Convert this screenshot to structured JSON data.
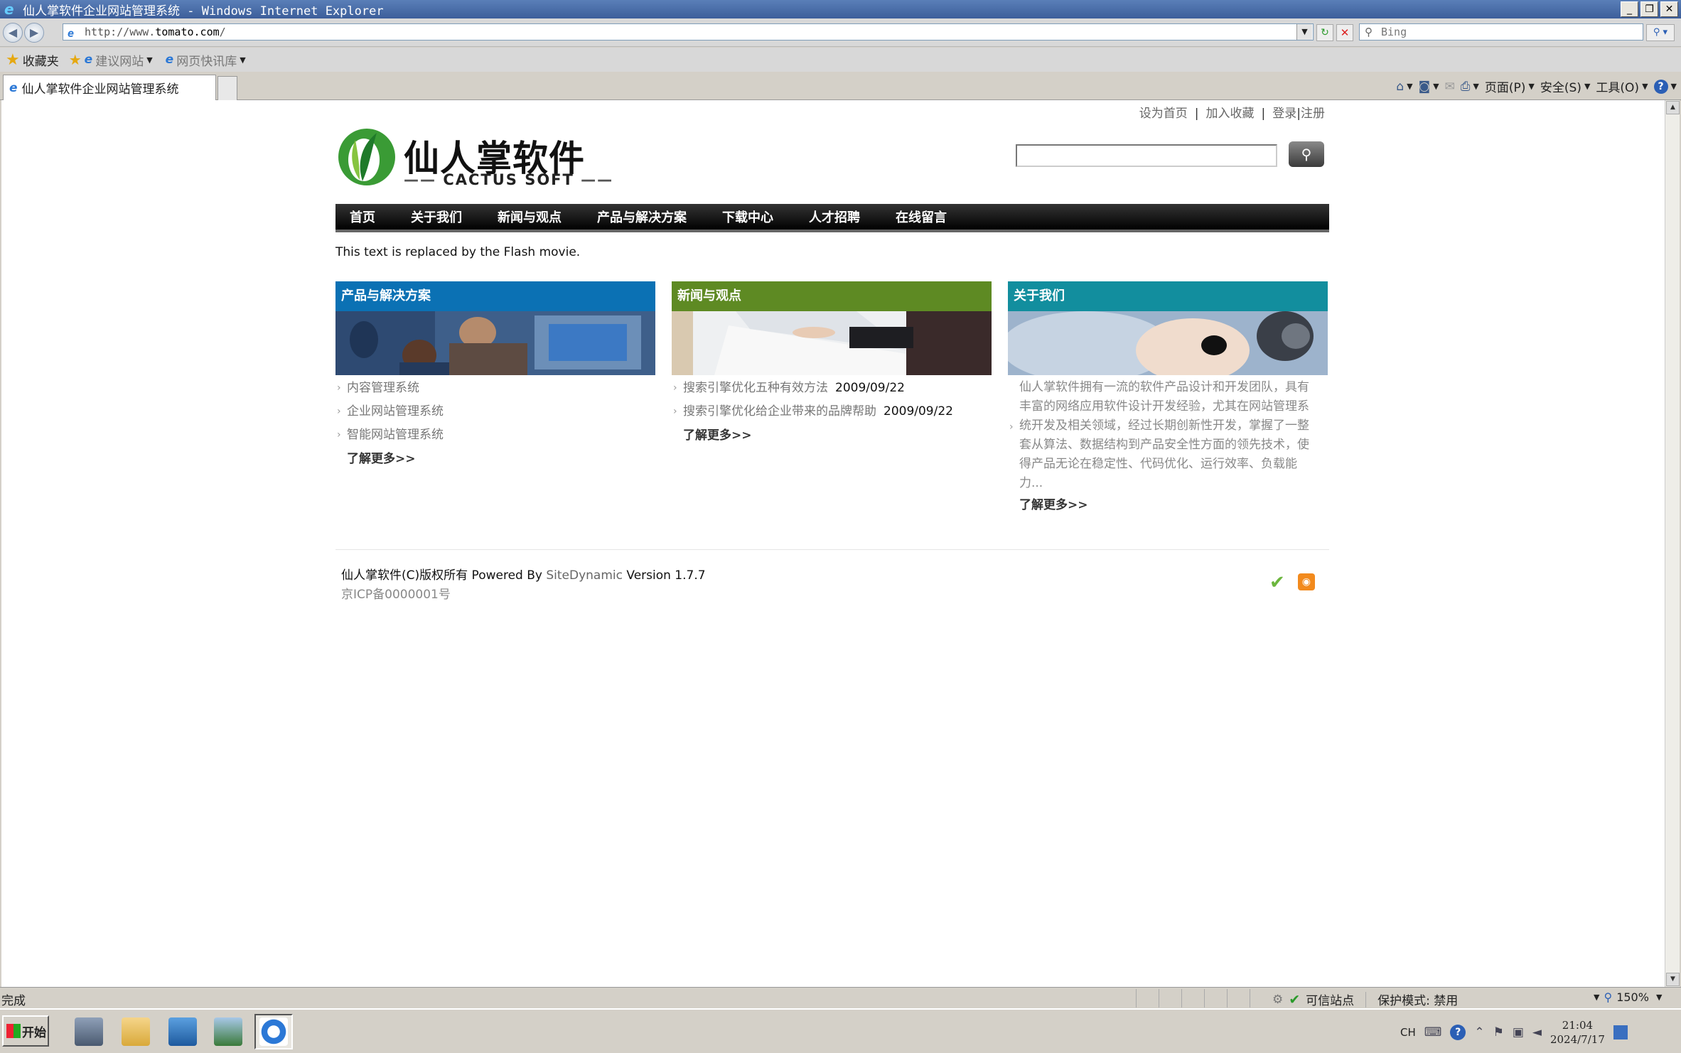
{
  "window": {
    "title": "仙人掌软件企业网站管理系统 - Windows Internet Explorer",
    "controls": [
      "_",
      "❐",
      "✕"
    ]
  },
  "addressbar": {
    "url_prefix": "http://www.",
    "url_host": "tomato.com",
    "url_suffix": "/",
    "search_placeholder": "Bing"
  },
  "favorites": {
    "label": "收藏夹",
    "items": [
      "建议网站",
      "网页快讯库"
    ]
  },
  "tab": {
    "label": "仙人掌软件企业网站管理系统"
  },
  "commandbar": {
    "page": "页面(P)",
    "safety": "安全(S)",
    "tools": "工具(O)"
  },
  "site": {
    "toplinks": {
      "homepage": "设为首页",
      "bookmark": "加入收藏",
      "login": "登录",
      "register": "注册"
    },
    "logo": {
      "cn": "仙人掌软件",
      "en": "CACTUS SOFT"
    },
    "nav": [
      "首页",
      "关于我们",
      "新闻与观点",
      "产品与解决方案",
      "下载中心",
      "人才招聘",
      "在线留言"
    ],
    "flash_text": "This text is replaced by the Flash movie.",
    "columns": {
      "products": {
        "title": "产品与解决方案",
        "items": [
          "内容管理系统",
          "企业网站管理系统",
          "智能网站管理系统"
        ],
        "more": "了解更多>>"
      },
      "news": {
        "title": "新闻与观点",
        "items": [
          {
            "text": "搜索引擎优化五种有效方法",
            "date": "2009/09/22"
          },
          {
            "text": "搜索引擎优化给企业带来的品牌帮助",
            "date": "2009/09/22"
          }
        ],
        "more": "了解更多>>"
      },
      "about": {
        "title": "关于我们",
        "text": "仙人掌软件拥有一流的软件产品设计和开发团队，具有丰富的网络应用软件设计开发经验，尤其在网站管理系统开发及相关领域，经过长期创新性开发，掌握了一整套从算法、数据结构到产品安全性方面的领先技术，使得产品无论在稳定性、代码优化、运行效率、负载能力...",
        "more": "了解更多>>"
      }
    },
    "footer": {
      "copyright": "仙人掌软件(C)版权所有",
      "powered_by": "Powered By",
      "product": "SiteDynamic",
      "version": "Version 1.7.7",
      "icp": "京ICP备0000001号"
    }
  },
  "statusbar": {
    "status": "完成",
    "zone": "可信站点",
    "protected_mode": "保护模式: 禁用",
    "zoom": "150%"
  },
  "taskbar": {
    "start": "开始",
    "lang": "CH",
    "time": "21:04",
    "date": "2024/7/17"
  },
  "colors": {
    "products_header": "#0b71b4",
    "news_header": "#5e8a23",
    "about_header": "#128e9e",
    "nav_bg": "#111111"
  }
}
